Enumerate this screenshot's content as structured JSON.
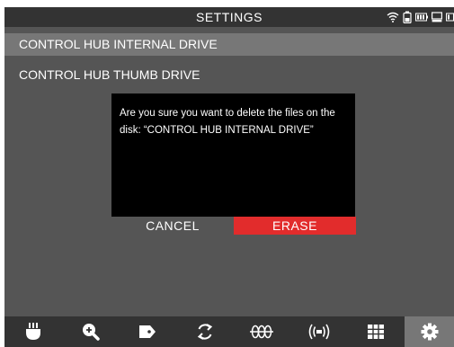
{
  "header": {
    "title": "SETTINGS",
    "status_icons": [
      "wifi-icon",
      "battery-icon",
      "battery-icon",
      "drive-icon",
      "battery-icon"
    ]
  },
  "drives": [
    {
      "label": "CONTROL HUB INTERNAL DRIVE",
      "selected": true
    },
    {
      "label": "CONTROL HUB THUMB DRIVE",
      "selected": false
    }
  ],
  "dialog": {
    "message": "Are you sure you want to delete the files on the disk: “CONTROL HUB INTERNAL DRIVE”",
    "cancel_label": "CANCEL",
    "erase_label": "ERASE"
  },
  "navbar": {
    "items": [
      {
        "icon": "probe-icon"
      },
      {
        "icon": "zoom-in-icon"
      },
      {
        "icon": "tag-icon"
      },
      {
        "icon": "rotate-icon"
      },
      {
        "icon": "signal-icon"
      },
      {
        "icon": "broadcast-icon"
      },
      {
        "icon": "grid-icon"
      },
      {
        "icon": "gear-icon",
        "active": true
      }
    ]
  },
  "colors": {
    "background": "#555555",
    "bar": "#333333",
    "selected_row": "#777777",
    "dialog": "#000000",
    "erase": "#e22c2c"
  }
}
